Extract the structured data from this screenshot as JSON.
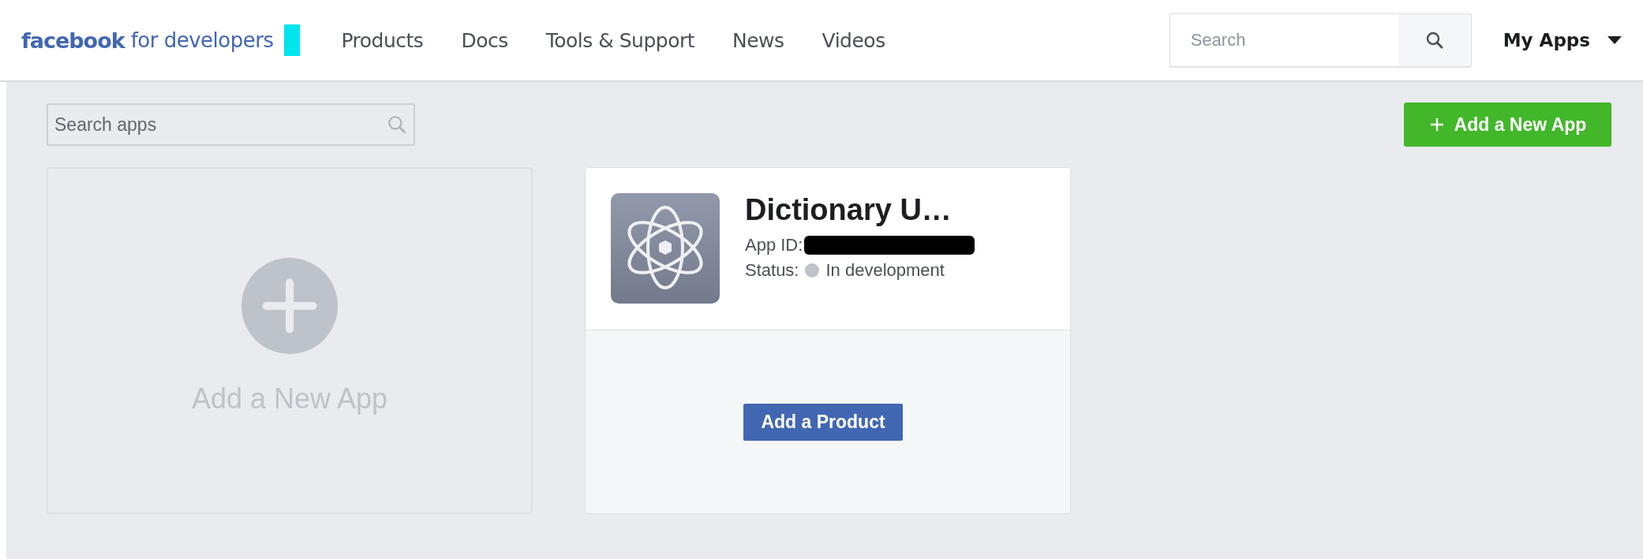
{
  "header": {
    "logo_brand": "facebook",
    "logo_suffix": "for developers",
    "nav": [
      "Products",
      "Docs",
      "Tools & Support",
      "News",
      "Videos"
    ],
    "search": {
      "placeholder": "Search"
    },
    "account_menu": "My Apps"
  },
  "toolbar": {
    "search_apps": {
      "placeholder": "Search apps"
    },
    "add_button": "Add a New App"
  },
  "add_card": {
    "label": "Add a New App"
  },
  "apps": [
    {
      "name": "Dictionary U…",
      "app_id_label": "App ID:",
      "status_label": "Status:",
      "status": "In development",
      "action": "Add a Product"
    }
  ]
}
